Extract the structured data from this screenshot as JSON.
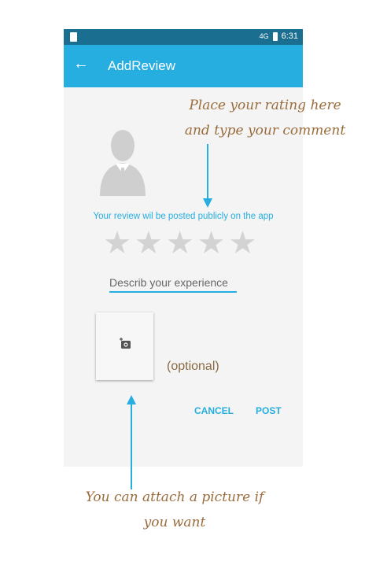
{
  "status_bar": {
    "network": "4G",
    "time": "6:31"
  },
  "app_bar": {
    "title": "AddReview",
    "back_icon": "arrow-back-icon"
  },
  "review": {
    "notice": "Your review wil be posted publicly on the app",
    "stars_total": 5,
    "comment_placeholder": "Describ your experience",
    "photo_icon": "add-photo-icon",
    "optional_label": "(optional)"
  },
  "actions": {
    "cancel": "CANCEL",
    "post": "POST"
  },
  "annotations": {
    "top_line1": "Place your rating here",
    "top_line2": "and type your comment",
    "bottom_line1": "You can attach a picture if",
    "bottom_line2": "you want"
  },
  "colors": {
    "accent": "#26aee0",
    "status_bar": "#1a6e8f",
    "annotation": "#9a6c3c"
  }
}
